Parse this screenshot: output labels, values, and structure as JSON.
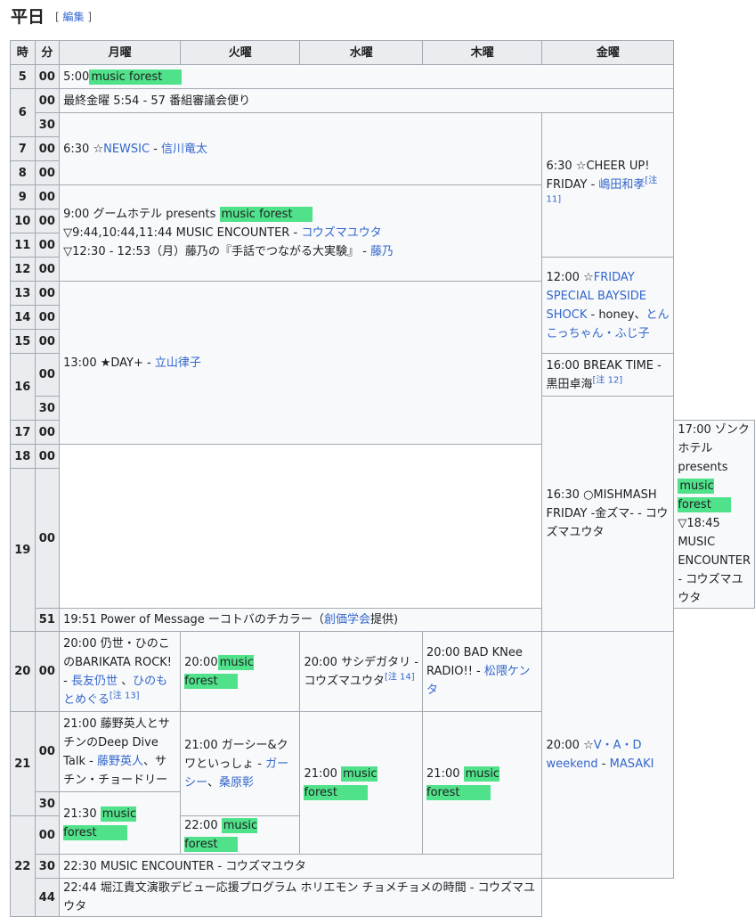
{
  "heading": {
    "title": "平日",
    "edit_open": "[",
    "edit_label": "編集",
    "edit_close": "]"
  },
  "columns": {
    "hour": "時",
    "min": "分",
    "mon": "月曜",
    "tue": "火曜",
    "wed": "水曜",
    "thu": "木曜",
    "fri": "金曜"
  },
  "rows": {
    "h5": "5",
    "h6": "6",
    "h7": "7",
    "h8": "8",
    "h9": "9",
    "h10": "10",
    "h11": "11",
    "h12": "12",
    "h13": "13",
    "h14": "14",
    "h15": "15",
    "h16": "16",
    "h17": "17",
    "h18": "18",
    "h19": "19",
    "h20": "20",
    "h21": "21",
    "h22": "22",
    "m00": "00",
    "m30": "30",
    "m51": "51",
    "m44": "44"
  },
  "cells": {
    "c0500_time": "5:00",
    "c0500_show": "music forest",
    "c0600": "最終金曜 5:54 - 57 番組審議会便り",
    "c0630_time": "6:30 ☆",
    "c0630_show": "NEWSIC",
    "c0630_sep": " - ",
    "c0630_host": "信川竜太",
    "fri0630_a": "6:30 ☆CHEER UP! FRIDAY - ",
    "fri0630_host": "嶋田和孝",
    "fri0630_note": "[注 11]",
    "c0900_a": "9:00 グームホテル presents ",
    "c0900_show": "music forest",
    "c0944_a": "▽9:44,10:44,11:44 MUSIC ENCOUNTER - ",
    "c0944_host": "コウズマユウタ",
    "c1230_a": "▽12:30 - 12:53（月）藤乃の『手話でつながる大実験』 - ",
    "c1230_host": "藤乃",
    "fri1200_a": "12:00 ☆",
    "fri1200_show": "FRIDAY SPECIAL BAYSIDE SHOCK",
    "fri1200_b": " - honey、",
    "fri1200_host": "とんこっちゃん・ふじ子",
    "c1300_a": "13:00 ★DAY+ - ",
    "c1300_host": "立山律子",
    "fri1600_a": "16:00 BREAK TIME - 黒田卓海",
    "fri1600_note": "[注 12]",
    "fri1630_a": "16:30 ○MISHMASH FRIDAY -金ズマ- - コウズマユウタ",
    "c1700_a": "17:00 ゾンクホテル presents ",
    "c1700_show": "music forest",
    "c1845": "▽18:45 MUSIC ENCOUNTER - コウズマユウタ",
    "c1951_a": "19:51 Power of Message ーコトバのチカラー（",
    "c1951_link": "創価学会",
    "c1951_b": "提供)",
    "mon2000_a": "20:00 仍世・ひのこのBARIKATA ROCK! - ",
    "mon2000_h1": "長友仍世",
    "mon2000_sep": " 、",
    "mon2000_h2": "ひのもとめぐる",
    "mon2000_note": "[注 13]",
    "tue2000_a": "20:00",
    "tue2000_show": "music forest",
    "wed2000_a": "20:00 サシデガタリ - コウズマユウタ",
    "wed2000_note": "[注 14]",
    "thu2000_a": "20:00 BAD KNee RADIO!! - ",
    "thu2000_host": "松隈ケンタ",
    "fri2000_a": "20:00 ☆",
    "fri2000_show": "V・A・D weekend",
    "fri2000_sep": " - ",
    "fri2000_host": "MASAKI",
    "mon2100_a": "21:00 藤野英人とサチンのDeep Dive Talk - ",
    "mon2100_h1": "藤野英人",
    "mon2100_b": "、サチン・チョードリー",
    "tue2100_a": "21:00 ガーシー&クワといっしょ - ",
    "tue2100_h1": "ガーシー",
    "tue2100_sep": "、",
    "tue2100_h2": "桑原彰",
    "wed2100_a": "21:00 ",
    "wed2100_show": "music forest",
    "thu2100_a": "21:00 ",
    "thu2100_show": "music forest",
    "mon2130_a": "21:30 ",
    "mon2130_show": "music forest",
    "tue2200_a": "22:00 ",
    "tue2200_show": "music forest",
    "c2230": "22:30 MUSIC ENCOUNTER - コウズマユウタ",
    "c2244": "22:44 堀江貴文演歌デビュー応援プログラム ホリエモン チョメチョメの時間 - コウズマユウタ"
  }
}
